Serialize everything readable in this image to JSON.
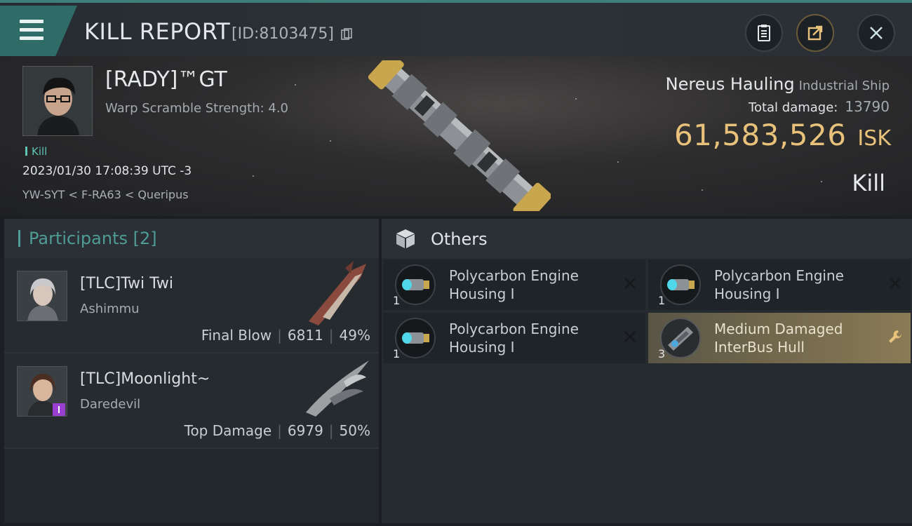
{
  "window": {
    "title": "KILL REPORT",
    "report_id": "[ID:8103475]"
  },
  "victim": {
    "pilot_name": "[RADY]™GT",
    "warp_scramble": "Warp Scramble Strength: 4.0",
    "kill_tag": "Kill",
    "datetime": "2023/01/30 17:08:39 UTC -3",
    "location": "YW-SYT < F-RA63 < Queripus",
    "ship_name": "Nereus Hauling",
    "ship_class": "Industrial Ship",
    "total_damage_label": "Total damage:",
    "total_damage": "13790",
    "isk_value": "61,583,526",
    "isk_unit": "ISK",
    "result": "Kill"
  },
  "participants": {
    "title": "Participants",
    "count": "[2]",
    "rows": [
      {
        "name": "[TLC]Twi Twi",
        "ship": "Ashimmu",
        "role": "Final Blow",
        "damage": "6811",
        "percent": "49%"
      },
      {
        "name": "[TLC]Moonlight~",
        "ship": "Daredevil",
        "role": "Top Damage",
        "damage": "6979",
        "percent": "50%"
      }
    ]
  },
  "others": {
    "title": "Others",
    "items": [
      {
        "qty": "1",
        "name": "Polycarbon Engine Housing I",
        "status": "destroyed"
      },
      {
        "qty": "1",
        "name": "Polycarbon Engine Housing I",
        "status": "destroyed"
      },
      {
        "qty": "1",
        "name": "Polycarbon Engine Housing I",
        "status": "destroyed"
      },
      {
        "qty": "3",
        "name": "Medium Damaged InterBus Hull",
        "status": "salvage"
      }
    ]
  },
  "colors": {
    "accent_teal": "#4f9c97",
    "isk_gold": "#e8c27a",
    "salvage_gold": "#8a7b55"
  }
}
